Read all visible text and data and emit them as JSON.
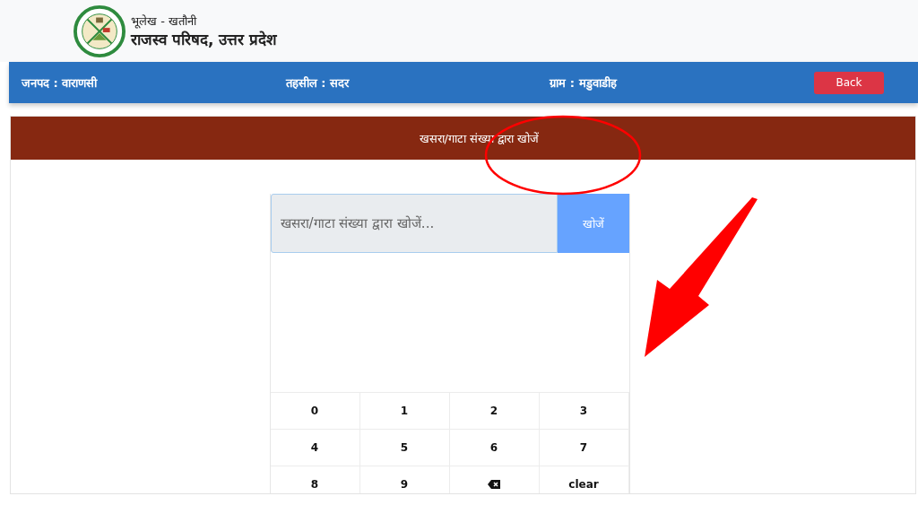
{
  "header": {
    "subtitle": "भूलेख - खतौनी",
    "title": "राजस्व परिषद, उत्तर प्रदेश"
  },
  "info_bar": {
    "items": [
      "जनपद : वाराणसी",
      "तहसील : सदर",
      "ग्राम : मडुवाडीह"
    ],
    "back_button": "Back"
  },
  "section_title": "खसरा/गाटा संख्या द्वारा खोजें",
  "search": {
    "placeholder": "खसरा/गाटा संख्या द्वारा खोजें...",
    "button": "खोजें"
  },
  "keypad": [
    {
      "kind": "digit",
      "label": "0"
    },
    {
      "kind": "digit",
      "label": "1"
    },
    {
      "kind": "digit",
      "label": "2"
    },
    {
      "kind": "digit",
      "label": "3"
    },
    {
      "kind": "digit",
      "label": "4"
    },
    {
      "kind": "digit",
      "label": "5"
    },
    {
      "kind": "digit",
      "label": "6"
    },
    {
      "kind": "digit",
      "label": "7"
    },
    {
      "kind": "digit",
      "label": "8"
    },
    {
      "kind": "digit",
      "label": "9"
    },
    {
      "kind": "backspace"
    },
    {
      "kind": "text",
      "label": "clear"
    }
  ]
}
